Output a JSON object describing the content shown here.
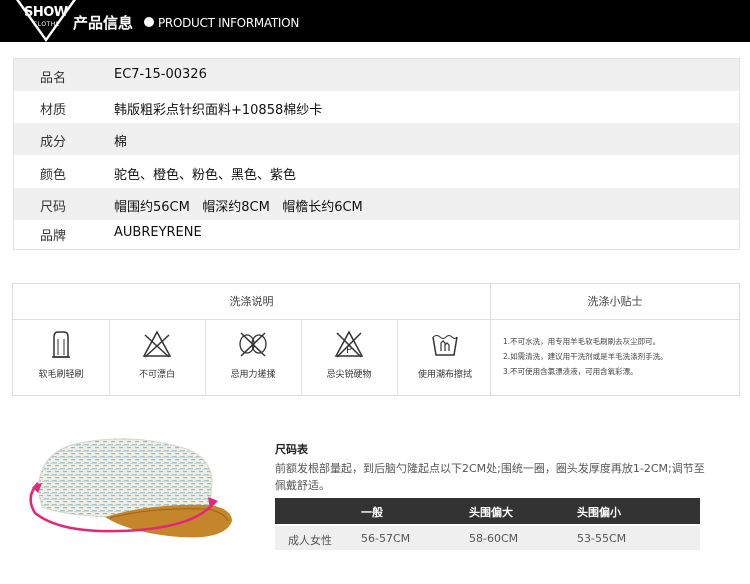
{
  "header": {
    "logo_line1": "SHOW",
    "logo_line2": "CLOTHE",
    "title_cn": "产品信息",
    "title_en": "PRODUCT INFORMATION"
  },
  "product_info": [
    {
      "label": "品名",
      "value": "EC7-15-00326"
    },
    {
      "label": "材质",
      "value": "韩版粗彩点针织面料+10858棉纱卡"
    },
    {
      "label": "成分",
      "value": "棉"
    },
    {
      "label": "颜色",
      "value": "驼色、橙色、粉色、黑色、紫色"
    },
    {
      "label": "尺码",
      "value": "帽围约56CM   帽深约8CM   帽檐长约6CM"
    },
    {
      "label": "品牌",
      "value": "AUBREYRENE"
    }
  ],
  "care": {
    "instructions_title": "洗涤说明",
    "tips_title": "洗涤小贴士",
    "items": [
      {
        "label": "软毛刷轻刷",
        "icon": "brush-icon"
      },
      {
        "label": "不可漂白",
        "icon": "no-bleach-icon"
      },
      {
        "label": "忌用力搓揉",
        "icon": "no-wring-icon"
      },
      {
        "label": "忌尖锐硬物",
        "icon": "no-sharp-icon"
      },
      {
        "label": "使用潮布擦拭",
        "icon": "damp-cloth-icon"
      }
    ],
    "tips": [
      "1.不可水洗，用专用羊毛软毛刷刷去灰尘即可。",
      "2.如需清洗，建议用干洗剂或是羊毛洗涤剂手洗。",
      "3.不可使用含氯漂渍液，可用含氧彩漂。"
    ]
  },
  "size_chart": {
    "title": "尺码表",
    "note": "前额发根部量起，到后脑勺隆起点以下2CM处;围统一圈，圈头发厚度再放1-2CM;调节至佩戴舒适。",
    "headers": [
      "",
      "一般",
      "头围偏大",
      "头围偏小"
    ],
    "row": [
      "成人女性",
      "56-57CM",
      "58-60CM",
      "53-55CM"
    ]
  },
  "colors": {
    "header_bg": "#000000",
    "accent_pink": "#e0287a",
    "table_head_bg": "#333333"
  }
}
